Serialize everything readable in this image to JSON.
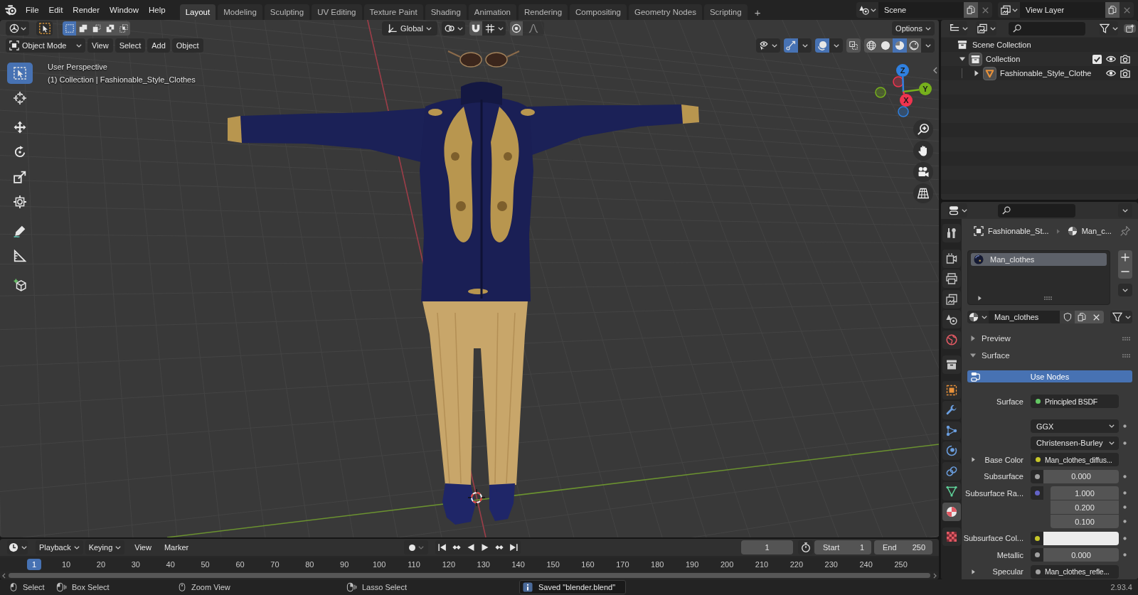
{
  "top_bar": {
    "menus": [
      "File",
      "Edit",
      "Render",
      "Window",
      "Help"
    ],
    "workspaces": [
      {
        "label": "Layout",
        "selected": true
      },
      {
        "label": "Modeling",
        "selected": false
      },
      {
        "label": "Sculpting",
        "selected": false
      },
      {
        "label": "UV Editing",
        "selected": false
      },
      {
        "label": "Texture Paint",
        "selected": false
      },
      {
        "label": "Shading",
        "selected": false
      },
      {
        "label": "Animation",
        "selected": false
      },
      {
        "label": "Rendering",
        "selected": false
      },
      {
        "label": "Compositing",
        "selected": false
      },
      {
        "label": "Geometry Nodes",
        "selected": false
      },
      {
        "label": "Scripting",
        "selected": false
      }
    ],
    "add_workspace": "+",
    "scene": "Scene",
    "view_layer": "View Layer"
  },
  "viewport": {
    "header": {
      "select_modes": [
        {
          "kind": "set",
          "selected": true
        },
        {
          "kind": "extend",
          "selected": false
        },
        {
          "kind": "subtract",
          "selected": false
        },
        {
          "kind": "difference",
          "selected": false
        },
        {
          "kind": "intersect",
          "selected": false
        }
      ],
      "orientation": "Global",
      "options": "Options",
      "mode": "Object Mode",
      "menus": [
        "View",
        "Select",
        "Add",
        "Object"
      ],
      "gizmos": true,
      "overlays": true,
      "xray": false,
      "shading": [
        {
          "kind": "wireframe",
          "selected": false
        },
        {
          "kind": "solid",
          "selected": false
        },
        {
          "kind": "material",
          "selected": true
        },
        {
          "kind": "rendered",
          "selected": false
        }
      ]
    },
    "tool_groups": [
      [
        {
          "kind": "select-box",
          "selected": true
        },
        {
          "kind": "cursor",
          "selected": false
        }
      ],
      [
        {
          "kind": "move",
          "selected": false
        },
        {
          "kind": "rotate",
          "selected": false
        },
        {
          "kind": "scale",
          "selected": false
        },
        {
          "kind": "transform",
          "selected": false
        }
      ],
      [
        {
          "kind": "annotate",
          "selected": false
        },
        {
          "kind": "measure",
          "selected": false
        }
      ],
      [
        {
          "kind": "add-cube",
          "selected": false
        }
      ]
    ],
    "view_name": "User Perspective",
    "object_info": "(1) Collection | Fashionable_Style_Clothes",
    "gizmo_axes": [
      {
        "label": "Z",
        "color": "#2f80e0"
      },
      {
        "label": "Y",
        "color": "#76b01c"
      },
      {
        "label": "X",
        "color": "#f0344f"
      }
    ]
  },
  "timeline": {
    "menus": [
      {
        "label": "Playback",
        "dropdown": true
      },
      {
        "label": "Keying",
        "dropdown": true
      },
      {
        "label": "View",
        "dropdown": false
      },
      {
        "label": "Marker",
        "dropdown": false
      }
    ],
    "current_frame": "1",
    "start_label": "Start",
    "start": "1",
    "end_label": "End",
    "end": "250",
    "ruler": [
      {
        "label": "1",
        "selected": true
      },
      {
        "label": "10",
        "selected": false
      },
      {
        "label": "20",
        "selected": false
      },
      {
        "label": "30",
        "selected": false
      },
      {
        "label": "40",
        "selected": false
      },
      {
        "label": "50",
        "selected": false
      },
      {
        "label": "60",
        "selected": false
      },
      {
        "label": "70",
        "selected": false
      },
      {
        "label": "80",
        "selected": false
      },
      {
        "label": "90",
        "selected": false
      },
      {
        "label": "100",
        "selected": false
      },
      {
        "label": "110",
        "selected": false
      },
      {
        "label": "120",
        "selected": false
      },
      {
        "label": "130",
        "selected": false
      },
      {
        "label": "140",
        "selected": false
      },
      {
        "label": "150",
        "selected": false
      },
      {
        "label": "160",
        "selected": false
      },
      {
        "label": "170",
        "selected": false
      },
      {
        "label": "180",
        "selected": false
      },
      {
        "label": "190",
        "selected": false
      },
      {
        "label": "200",
        "selected": false
      },
      {
        "label": "210",
        "selected": false
      },
      {
        "label": "220",
        "selected": false
      },
      {
        "label": "230",
        "selected": false
      },
      {
        "label": "240",
        "selected": false
      },
      {
        "label": "250",
        "selected": false
      }
    ]
  },
  "outliner": {
    "tree": [
      {
        "name": "Scene Collection",
        "kind": "scene-collection",
        "children": [
          {
            "name": "Collection",
            "kind": "collection",
            "expanded": true,
            "checked": true,
            "children": [
              {
                "name": "Fashionable_Style_Clothe",
                "kind": "mesh-object",
                "expanded": false
              }
            ]
          }
        ]
      }
    ]
  },
  "properties": {
    "tab_groups": [
      [
        {
          "kind": "tool",
          "selected": false
        }
      ],
      [
        {
          "kind": "render",
          "selected": false
        },
        {
          "kind": "output",
          "selected": false
        },
        {
          "kind": "view-layer",
          "selected": false
        },
        {
          "kind": "scene",
          "selected": false
        },
        {
          "kind": "world",
          "selected": false
        }
      ],
      [
        {
          "kind": "collection",
          "selected": false
        }
      ],
      [
        {
          "kind": "object",
          "selected": false
        },
        {
          "kind": "modifiers",
          "selected": false
        },
        {
          "kind": "particles",
          "selected": false
        },
        {
          "kind": "physics",
          "selected": false
        },
        {
          "kind": "constraints",
          "selected": false
        },
        {
          "kind": "data",
          "selected": false
        },
        {
          "kind": "material",
          "selected": true
        }
      ],
      [
        {
          "kind": "texture",
          "selected": false
        }
      ]
    ],
    "breadcrumb": [
      {
        "kind": "object",
        "label": "Fashionable_St..."
      },
      {
        "kind": "material",
        "label": "Man_c..."
      }
    ],
    "material_slots": [
      {
        "name": "Man_clothes",
        "selected": true
      }
    ],
    "material": "Man_clothes",
    "panels": [
      {
        "title": "Preview",
        "expanded": false
      },
      {
        "title": "Surface",
        "expanded": true,
        "use_nodes": "Use Nodes",
        "fields": [
          {
            "kind": "link",
            "label": "Surface",
            "value": "Principled BSDF",
            "color": "#63c763"
          },
          {
            "kind": "dropdown",
            "value": "GGX"
          },
          {
            "kind": "dropdown",
            "value": "Christensen-Burley"
          },
          {
            "kind": "link",
            "label": "Base Color",
            "value": "Man_clothes_diffus...",
            "color": "#c7c729",
            "expanded": false
          },
          {
            "kind": "number",
            "label": "Subsurface",
            "value": "0.000",
            "color": "#a1a1a1"
          },
          {
            "kind": "vector",
            "label": "Subsurface Ra...",
            "values": [
              "1.000",
              "0.200",
              "0.100"
            ],
            "color": "#6363c7"
          },
          {
            "kind": "color",
            "label": "Subsurface Col...",
            "color": "#c7c729",
            "swatch": {
              "color": "#ececec"
            }
          },
          {
            "kind": "number",
            "label": "Metallic",
            "value": "0.000",
            "color": "#a1a1a1"
          },
          {
            "kind": "link",
            "label": "Specular",
            "value": "Man_clothes_refle...",
            "color": "#a1a1a1",
            "expanded": false
          }
        ]
      }
    ]
  },
  "status_bar": {
    "hints": [
      {
        "kind": "mouse-left",
        "label": "Select"
      },
      {
        "kind": "mouse-left-drag",
        "label": "Box Select"
      },
      {
        "kind": "mouse-middle",
        "label": "Zoom View"
      },
      {
        "kind": "mouse-right-drag",
        "label": "Lasso Select"
      }
    ],
    "message": "Saved \"blender.blend\"",
    "version": "2.93.4"
  }
}
